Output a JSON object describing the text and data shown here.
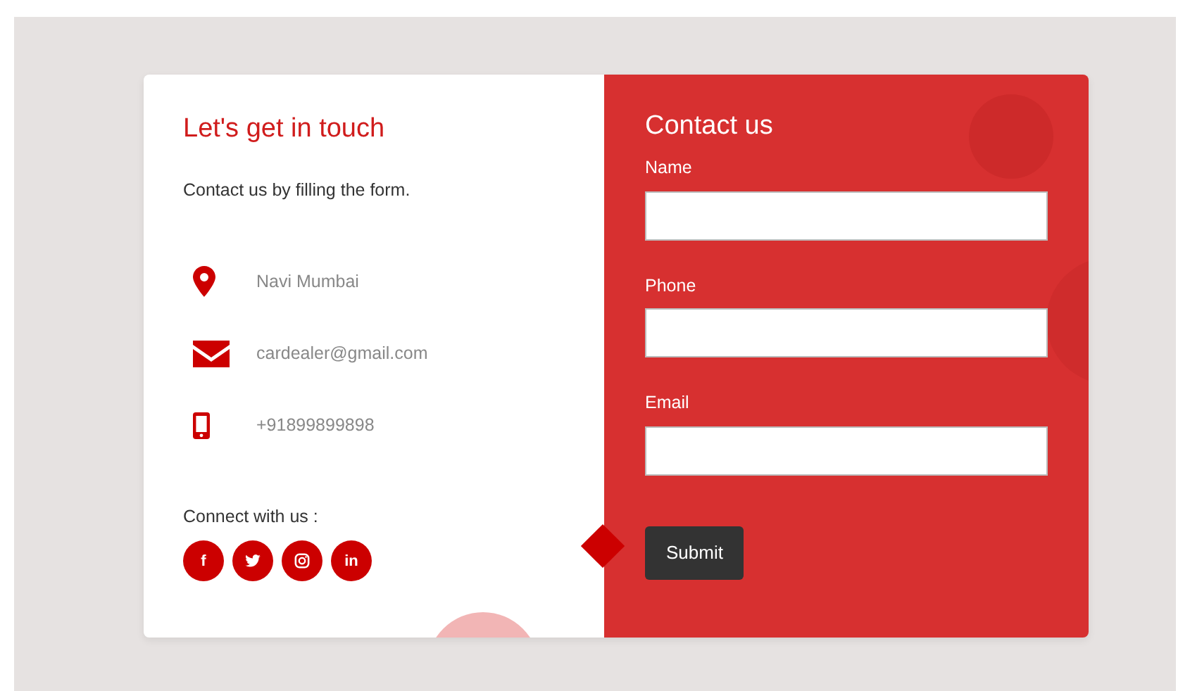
{
  "info": {
    "title": "Let's get in touch",
    "subtitle": "Contact us by filling the form.",
    "items": [
      {
        "kind": "location",
        "text": "Navi Mumbai"
      },
      {
        "kind": "email",
        "text": "cardealer@gmail.com"
      },
      {
        "kind": "phone",
        "text": "+91899899898"
      }
    ],
    "connect_label": "Connect with us :",
    "socials": [
      {
        "kind": "facebook",
        "glyph": "f"
      },
      {
        "kind": "twitter"
      },
      {
        "kind": "instagram"
      },
      {
        "kind": "linkedin",
        "glyph": "in"
      }
    ]
  },
  "form": {
    "title": "Contact us",
    "fields": [
      {
        "label": "Name"
      },
      {
        "label": "Phone"
      },
      {
        "label": "Email"
      }
    ],
    "submit": "Submit"
  }
}
